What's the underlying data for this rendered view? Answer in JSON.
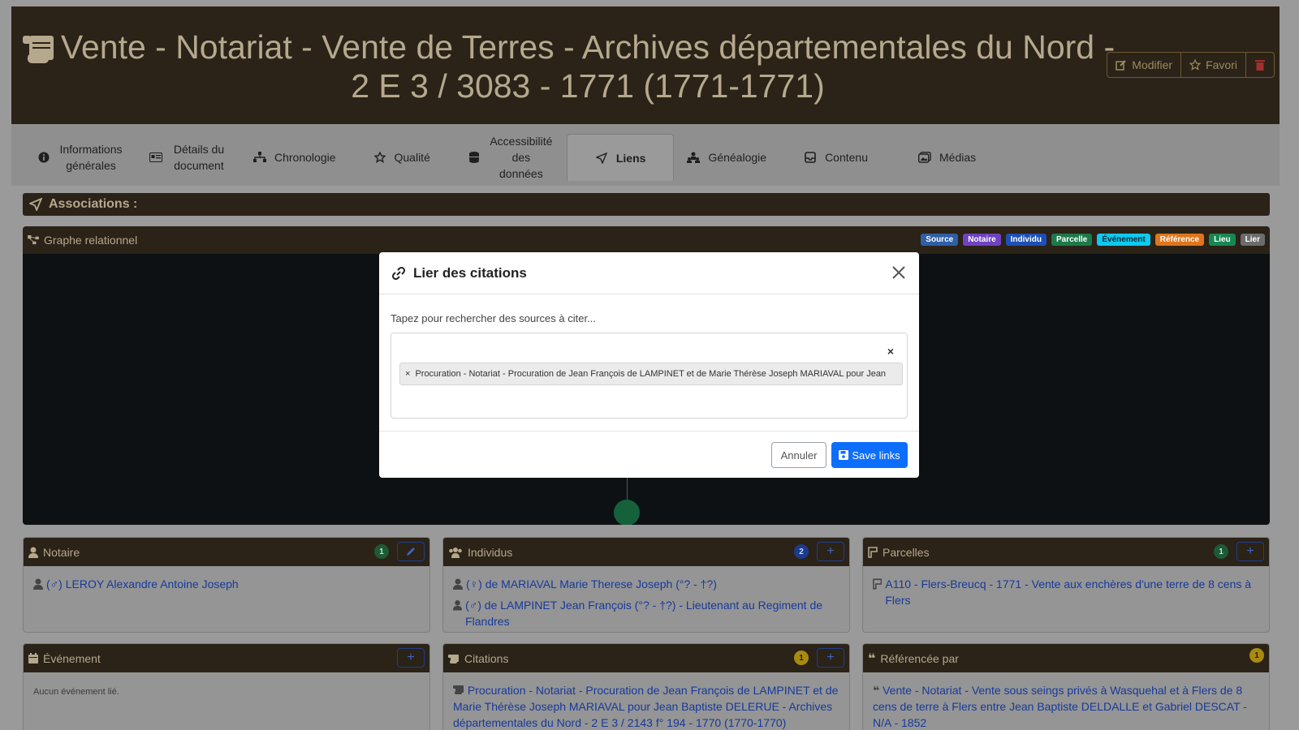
{
  "header": {
    "title": "Vente - Notariat - Vente de Terres - Archives départementales du Nord - 2 E 3 / 3083 - 1771 (1771-1771)",
    "buttons": {
      "modify": "Modifier",
      "favorite": "Favori"
    }
  },
  "tabs": [
    {
      "label": "Informations générales",
      "icon": "info-icon"
    },
    {
      "label": "Détails du document",
      "icon": "id-card-icon"
    },
    {
      "label": "Chronologie",
      "icon": "sitemap-icon"
    },
    {
      "label": "Qualité",
      "icon": "star-icon"
    },
    {
      "label": "Accessibilité des données",
      "icon": "database-icon"
    },
    {
      "label": "Liens",
      "icon": "send-icon",
      "active": true
    },
    {
      "label": "Généalogie",
      "icon": "family-tree-icon"
    },
    {
      "label": "Contenu",
      "icon": "inbox-icon"
    },
    {
      "label": "Médias",
      "icon": "images-icon"
    }
  ],
  "associations": {
    "title": "Associations :"
  },
  "graph": {
    "title": "Graphe relationnel",
    "legend": [
      {
        "label": "Source",
        "color": "#2f5fa6"
      },
      {
        "label": "Notaire",
        "color": "#6f42c1"
      },
      {
        "label": "Individu",
        "color": "#1d4fb5"
      },
      {
        "label": "Parcelle",
        "color": "#1c7a4a"
      },
      {
        "label": "Événement",
        "color": "#0dcaf0",
        "text": "#0b2a33"
      },
      {
        "label": "Référence",
        "color": "#e0751b"
      },
      {
        "label": "Lieu",
        "color": "#198754"
      },
      {
        "label": "Lier",
        "color": "#6c6c6c"
      }
    ]
  },
  "cards": {
    "notaire": {
      "title": "Notaire",
      "count": "1",
      "items": [
        "(♂) LEROY Alexandre Antoine Joseph"
      ]
    },
    "individus": {
      "title": "Individus",
      "count": "2",
      "items": [
        "(♀) de MARIAVAL Marie Therese Joseph (°? - †?)",
        "(♂) de LAMPINET Jean François (°? - †?) - Lieutenant au Regiment de Flandres"
      ]
    },
    "parcelles": {
      "title": "Parcelles",
      "count": "1",
      "items": [
        "A110 - Flers-Breucq - 1771 - Vente aux enchères d'une terre de 8 cens à Flers"
      ]
    },
    "evenement": {
      "title": "Événement",
      "empty": "Aucun événement lié."
    },
    "citations": {
      "title": "Citations",
      "count": "1",
      "items": [
        "Procuration - Notariat - Procuration de Jean François de LAMPINET et de Marie Thérèse Joseph MARIAVAL pour Jean Baptiste DELERUE - Archives départementales du Nord - 2 E 3 / 2143 f° 194 - 1770 (1770-1770)"
      ]
    },
    "referencee": {
      "title": "Référencée par",
      "count": "1",
      "items": [
        "Vente - Notariat - Vente sous seings privés à Wasquehal et à Flers de 8 cens de terre à Flers entre Jean Baptiste DELDALLE et Gabriel DESCAT - N/A - 1852"
      ]
    }
  },
  "modal": {
    "title": "Lier des citations",
    "label": "Tapez pour rechercher des sources à citer...",
    "clear": "×",
    "selected": "Procuration - Notariat - Procuration de Jean François de LAMPINET et de Marie Thérèse Joseph MARIAVAL pour Jean",
    "cancel": "Annuler",
    "save": "Save links"
  }
}
